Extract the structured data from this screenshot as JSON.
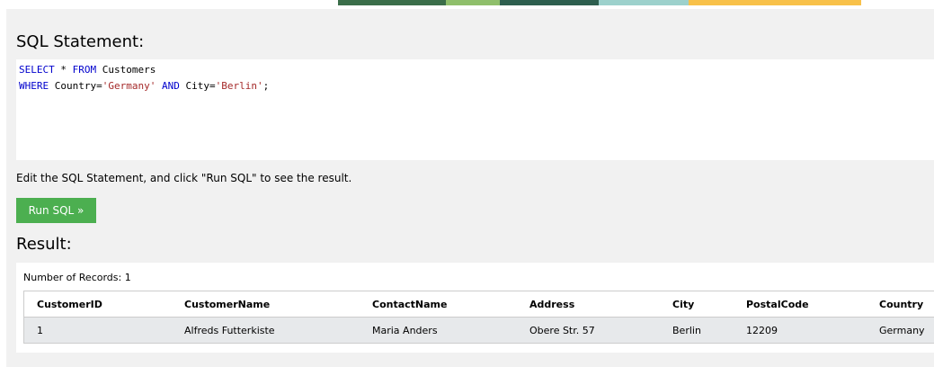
{
  "sql_section": {
    "heading": "SQL Statement:",
    "line1": [
      {
        "text": "SELECT",
        "kind": "kw"
      },
      {
        "text": " * ",
        "kind": "plain"
      },
      {
        "text": "FROM",
        "kind": "kw"
      },
      {
        "text": " Customers",
        "kind": "plain"
      }
    ],
    "line2": [
      {
        "text": "WHERE",
        "kind": "kw"
      },
      {
        "text": " Country=",
        "kind": "plain"
      },
      {
        "text": "'Germany'",
        "kind": "str"
      },
      {
        "text": " ",
        "kind": "plain"
      },
      {
        "text": "AND",
        "kind": "kw"
      },
      {
        "text": " City=",
        "kind": "plain"
      },
      {
        "text": "'Berlin'",
        "kind": "str"
      },
      {
        "text": ";",
        "kind": "plain"
      }
    ]
  },
  "hint": "Edit the SQL Statement, and click \"Run SQL\" to see the result.",
  "run_button": "Run SQL »",
  "result": {
    "heading": "Result:",
    "records_label": "Number of Records: 1",
    "columns": [
      "CustomerID",
      "CustomerName",
      "ContactName",
      "Address",
      "City",
      "PostalCode",
      "Country"
    ],
    "rows": [
      [
        "1",
        "Alfreds Futterkiste",
        "Maria Anders",
        "Obere Str. 57",
        "Berlin",
        "12209",
        "Germany"
      ]
    ]
  },
  "colors": {
    "button": "#4caf50",
    "keyword": "#0000cd",
    "string": "#a52a2a",
    "panel": "#f1f1f1",
    "row": "#e7e9eb"
  }
}
